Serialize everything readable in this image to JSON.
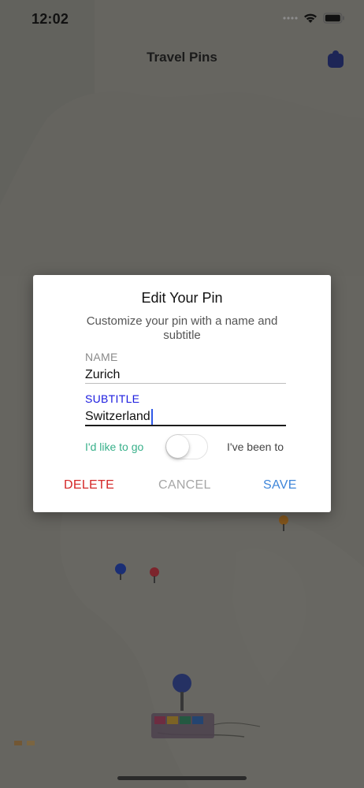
{
  "status_bar": {
    "time": "12:02"
  },
  "nav": {
    "title": "Travel Pins"
  },
  "dialog": {
    "title": "Edit Your Pin",
    "message": "Customize your pin with a name and subtitle",
    "fields": {
      "name": {
        "label": "NAME",
        "value": "Zurich"
      },
      "subtitle": {
        "label": "SUBTITLE",
        "value": "Switzerland"
      }
    },
    "toggle": {
      "left_label": "I'd like to go",
      "right_label": "I've been to",
      "is_on": false
    },
    "actions": {
      "delete": "DELETE",
      "cancel": "CANCEL",
      "save": "SAVE"
    }
  },
  "colors": {
    "delete": "#d42727",
    "cancel": "#a6a6a6",
    "save": "#3f86d9",
    "toggle_left_label": "#38b08a",
    "subtitle_label_active": "#1a1adf",
    "name_label": "#8a8a8a"
  },
  "icons": [
    "wifi-icon",
    "battery-icon",
    "signal-icon",
    "nav-action-icon",
    "map-pin-icon"
  ]
}
